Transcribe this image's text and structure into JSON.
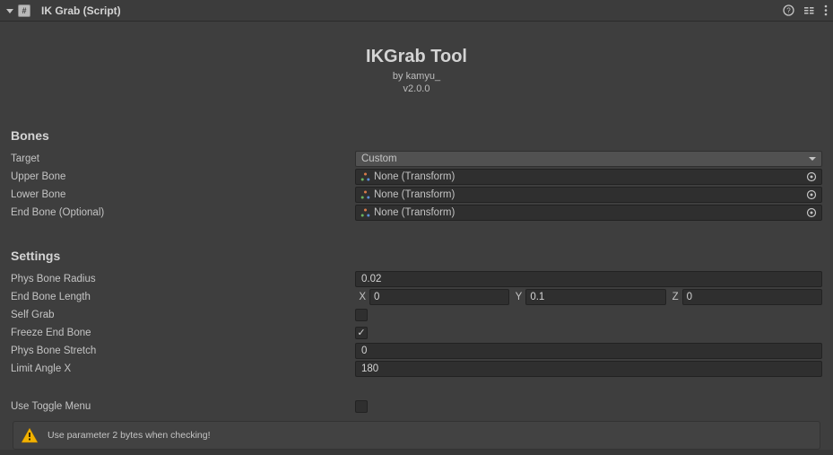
{
  "header": {
    "component_title": "IK Grab (Script)"
  },
  "tool": {
    "title": "IKGrab Tool",
    "author": "by kamyu_",
    "version": "v2.0.0"
  },
  "bones": {
    "section_title": "Bones",
    "target_label": "Target",
    "target_value": "Custom",
    "upper_label": "Upper Bone",
    "upper_value": "None (Transform)",
    "lower_label": "Lower Bone",
    "lower_value": "None (Transform)",
    "end_label": "End Bone (Optional)",
    "end_value": "None (Transform)"
  },
  "settings": {
    "section_title": "Settings",
    "phys_bone_radius_label": "Phys Bone Radius",
    "phys_bone_radius_value": "0.02",
    "end_bone_length_label": "End Bone Length",
    "end_bone_length_x_label": "X",
    "end_bone_length_x": "0",
    "end_bone_length_y_label": "Y",
    "end_bone_length_y": "0.1",
    "end_bone_length_z_label": "Z",
    "end_bone_length_z": "0",
    "self_grab_label": "Self Grab",
    "self_grab_checked": false,
    "freeze_end_bone_label": "Freeze End Bone",
    "freeze_end_bone_checked": true,
    "phys_bone_stretch_label": "Phys Bone Stretch",
    "phys_bone_stretch_value": "0",
    "limit_angle_x_label": "Limit Angle X",
    "limit_angle_x_value": "180"
  },
  "toggle_menu": {
    "label": "Use Toggle Menu",
    "checked": false
  },
  "helpbox": {
    "message": "Use parameter 2 bytes when checking!"
  }
}
